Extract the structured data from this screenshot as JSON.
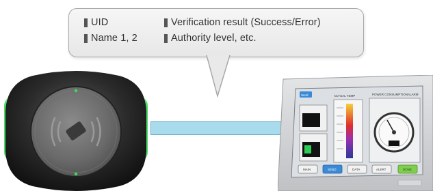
{
  "callout": {
    "fields": [
      {
        "label": "UID"
      },
      {
        "label": "Verification result (Success/Error)"
      },
      {
        "label": "Name 1, 2"
      },
      {
        "label": "Authority level, etc."
      }
    ]
  },
  "hmi": {
    "header_label": "Send",
    "graph_title": "ACTUAL TEMP",
    "gauge_title": "POWER CONSUMPTION",
    "alarm_label": "ALARM",
    "buttons": [
      "MAIN",
      "SEND",
      "DATA",
      "ALERT",
      "DONE"
    ]
  },
  "colors": {
    "led_green": "#3ddc5a",
    "cable_fill": "#a8dcec",
    "cable_border": "#5fa9c6",
    "panel_frame": "#cfd1d4",
    "active_button": "#3a8ad8",
    "done_button": "#7ed04a"
  },
  "icons": [
    "rfid-card-icon",
    "wireless-signal-icon"
  ]
}
